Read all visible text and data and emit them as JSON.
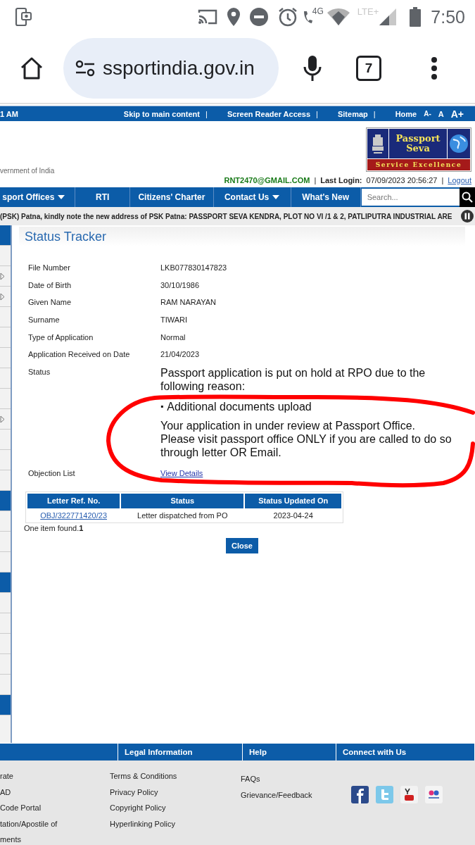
{
  "status_bar": {
    "network_label": "4G",
    "lte_label": "LTE+",
    "time": "7:50"
  },
  "browser": {
    "url": "ssportindia.gov.in",
    "tab_count": "7"
  },
  "top_bar": {
    "time_fragment": "1 AM",
    "separator": "|",
    "links": [
      "Skip to main content",
      "Screen Reader Access",
      "Sitemap",
      "Home"
    ],
    "font_sizes": [
      "A-",
      "A",
      "A+"
    ]
  },
  "header": {
    "tagline": "vernment of India",
    "logo": {
      "title_line_1": "Passport",
      "title_line_2": "Seva",
      "slogan": "Service Excellence"
    },
    "user_email": "RNT2470@GMAIL.COM",
    "separator": "|",
    "last_login_label": "Last Login:",
    "last_login_value": "07/09/2023 20:56:27",
    "logout": "Logout"
  },
  "nav": {
    "items": [
      {
        "label": "sport Offices",
        "has_menu": true
      },
      {
        "label": "RTI",
        "has_menu": false
      },
      {
        "label": "Citizens' Charter",
        "has_menu": false
      },
      {
        "label": "Contact Us",
        "has_menu": true
      },
      {
        "label": "What's New",
        "has_menu": false
      }
    ],
    "search": {
      "placeholder": "Search..."
    }
  },
  "ticker": {
    "text": "(PSK) Patna, kindly note the new address of PSK Patna: PASSPORT SEVA KENDRA, PLOT NO VI /1 & 2, PATLIPUTRA INDUSTRIAL ARE"
  },
  "sidebar": {
    "items": [
      {
        "kind": "blue"
      },
      {
        "kind": "plain"
      },
      {
        "kind": "arrow"
      },
      {
        "kind": "arrow"
      },
      {
        "kind": "plain"
      },
      {
        "kind": "plain"
      },
      {
        "kind": "plain"
      },
      {
        "kind": "plain"
      },
      {
        "kind": "plain"
      },
      {
        "kind": "arrow"
      },
      {
        "kind": "plain"
      },
      {
        "kind": "plain"
      },
      {
        "kind": "plain"
      },
      {
        "kind": "blue"
      },
      {
        "kind": "plain"
      },
      {
        "kind": "plain"
      },
      {
        "kind": "plain"
      },
      {
        "kind": "blue"
      },
      {
        "kind": "plain"
      },
      {
        "kind": "plain"
      },
      {
        "kind": "plain"
      },
      {
        "kind": "plain"
      },
      {
        "kind": "plain"
      },
      {
        "kind": "blue"
      }
    ]
  },
  "status_tracker": {
    "title": "Status Tracker",
    "fields": [
      {
        "label": "File Number",
        "value": "LKB077830147823"
      },
      {
        "label": "Date of Birth",
        "value": "30/10/1986"
      },
      {
        "label": "Given Name",
        "value": "RAM NARAYAN"
      },
      {
        "label": "Surname",
        "value": "TIWARI"
      },
      {
        "label": "Type of Application",
        "value": "Normal"
      },
      {
        "label": "Application Received on Date",
        "value": "21/04/2023"
      }
    ],
    "status": {
      "label": "Status",
      "message": "Passport application is put on hold at RPO due to the following reason:",
      "reasons": [
        {
          "bullet": "▪",
          "text": "Additional documents upload"
        }
      ],
      "note_lines": [
        "Your application in under review at Passport Office.",
        "Please visit passport office ONLY if you are called to do so through letter OR Email."
      ]
    },
    "objection": {
      "label": "Objection List",
      "link": "View Details"
    },
    "table": {
      "columns": [
        "Letter Ref. No.",
        "Status",
        "Status Updated On"
      ],
      "rows": [
        {
          "ref": "OBJ/322771420/23",
          "status": "Letter dispatched from PO",
          "updated": "2023-04-24"
        }
      ]
    },
    "result_count": "One item found.**1**",
    "close_button": "Close"
  },
  "footer": {
    "columns": [
      {
        "links": [
          "rate",
          "AD",
          " Code Portal",
          "tation/Apostile of",
          "ments"
        ]
      },
      {
        "heading": "Legal Information",
        "links": [
          "Terms & Conditions",
          "Privacy Policy",
          "Copyright Policy",
          "Hyperlinking Policy"
        ]
      },
      {
        "heading": "Help",
        "links": [
          "FAQs",
          "Grievance/Feedback"
        ]
      },
      {
        "heading": "Connect with Us"
      }
    ]
  }
}
